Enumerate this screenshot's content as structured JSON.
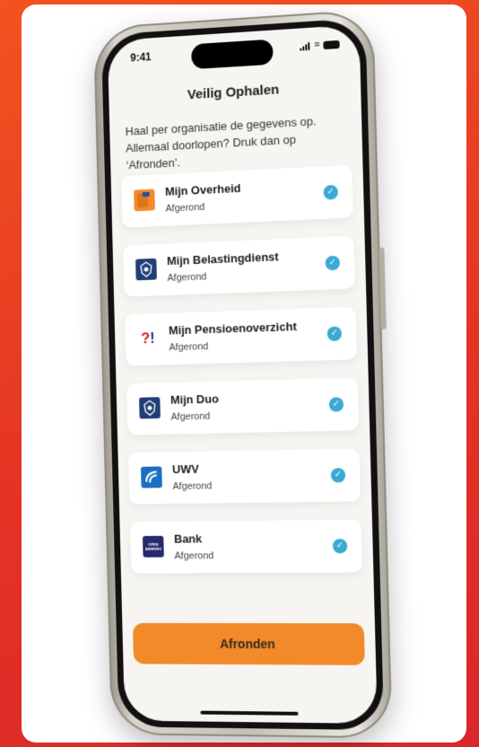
{
  "colors": {
    "background": "#e43325",
    "accent_button": "#f28a2a",
    "check": "#3aa9d4",
    "screen_bg": "#f7f5f2"
  },
  "status_bar": {
    "time": "9:41"
  },
  "header": {
    "title": "Veilig Ophalen"
  },
  "intro": {
    "text": "Haal per organisatie de gegevens op. Allemaal doorlopen? Druk dan op ‘Afronden’."
  },
  "items": [
    {
      "name": "Mijn Overheid",
      "status": "Afgerond",
      "icon": "mijn-overheid-logo"
    },
    {
      "name": "Mijn Belastingdienst",
      "status": "Afgerond",
      "icon": "rijkswapen-logo"
    },
    {
      "name": "Mijn Pensioenoverzicht",
      "status": "Afgerond",
      "icon": "pensioen-question-exclamation-logo"
    },
    {
      "name": "Mijn Duo",
      "status": "Afgerond",
      "icon": "rijkswapen-logo"
    },
    {
      "name": "UWV",
      "status": "Afgerond",
      "icon": "uwv-logo"
    },
    {
      "name": "Bank",
      "status": "Afgerond",
      "icon": "open-banking-logo",
      "logo_text": "OPEN BANKING"
    }
  ],
  "cta": {
    "label": "Afronden"
  }
}
